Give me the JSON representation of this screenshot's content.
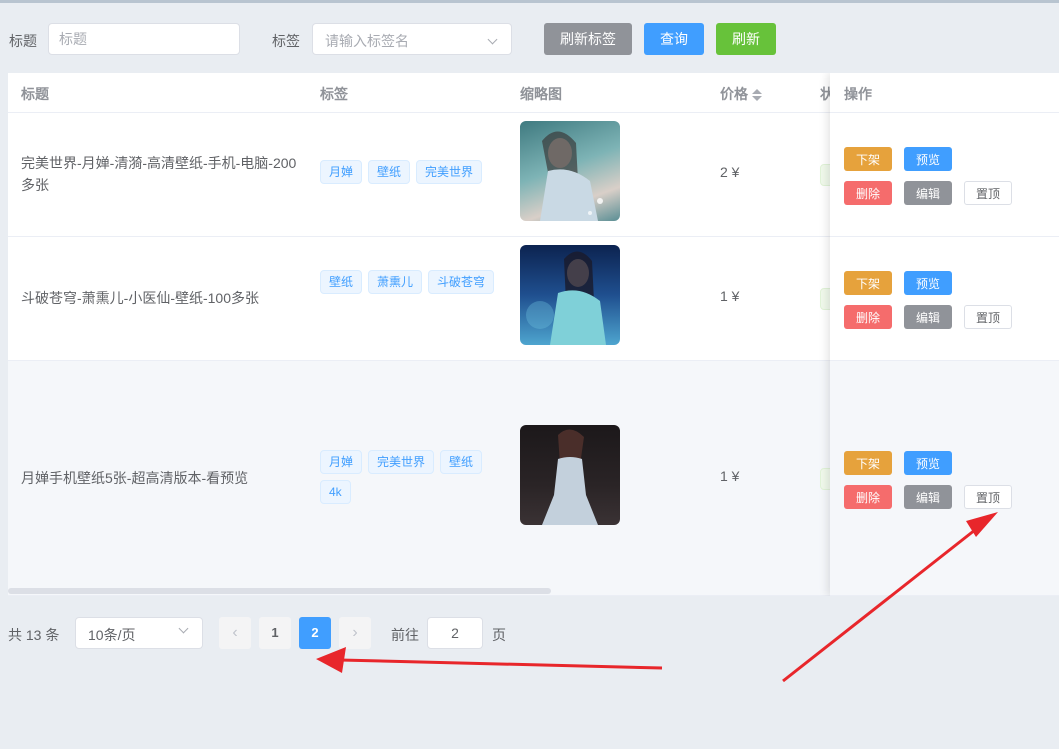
{
  "filters": {
    "title_label": "标题",
    "title_placeholder": "标题",
    "tag_label": "标签",
    "tag_placeholder": "请输入标签名",
    "refresh_tags_label": "刷新标签",
    "query_label": "查询",
    "refresh_label": "刷新"
  },
  "table": {
    "headers": {
      "title": "标题",
      "tags": "标签",
      "thumbnail": "缩略图",
      "price": "价格",
      "status": "状",
      "actions": "操作"
    },
    "rows": [
      {
        "title": "完美世界-月婵-清漪-高清壁纸-手机-电脑-200多张",
        "tags": [
          "月婵",
          "壁纸",
          "完美世界"
        ],
        "price": "2 ¥",
        "thumb_colors": [
          "#4d8a8c",
          "#9fc7c9",
          "#e8d9cf"
        ]
      },
      {
        "title": "斗破苍穹-萧熏儿-小医仙-壁纸-100多张",
        "tags": [
          "壁纸",
          "萧熏儿",
          "斗破苍穹"
        ],
        "price": "1 ¥",
        "thumb_colors": [
          "#0f2a5a",
          "#3d7ebf",
          "#9fd8e8"
        ]
      },
      {
        "title": "月婵手机壁纸5张-超高清版本-看预览",
        "tags": [
          "月婵",
          "完美世界",
          "壁纸",
          "4k"
        ],
        "price": "1 ¥",
        "thumb_colors": [
          "#1e1a1c",
          "#6a4a48",
          "#b9c6d6"
        ]
      }
    ],
    "actions": {
      "unlist": "下架",
      "preview": "预览",
      "delete": "删除",
      "edit": "编辑",
      "pin": "置顶"
    }
  },
  "pagination": {
    "total_text": "共 13 条",
    "page_size": "10条/页",
    "pages": [
      "1",
      "2"
    ],
    "current_page": "2",
    "goto_label": "前往",
    "goto_value": "2",
    "page_unit": "页",
    "prev_icon": "‹",
    "next_icon": "›"
  },
  "colors": {
    "primary": "#409eff",
    "success": "#67c23a",
    "warning": "#e6a23c",
    "danger": "#f56c6c",
    "info": "#909399",
    "annotation_arrow": "#e8262b"
  }
}
